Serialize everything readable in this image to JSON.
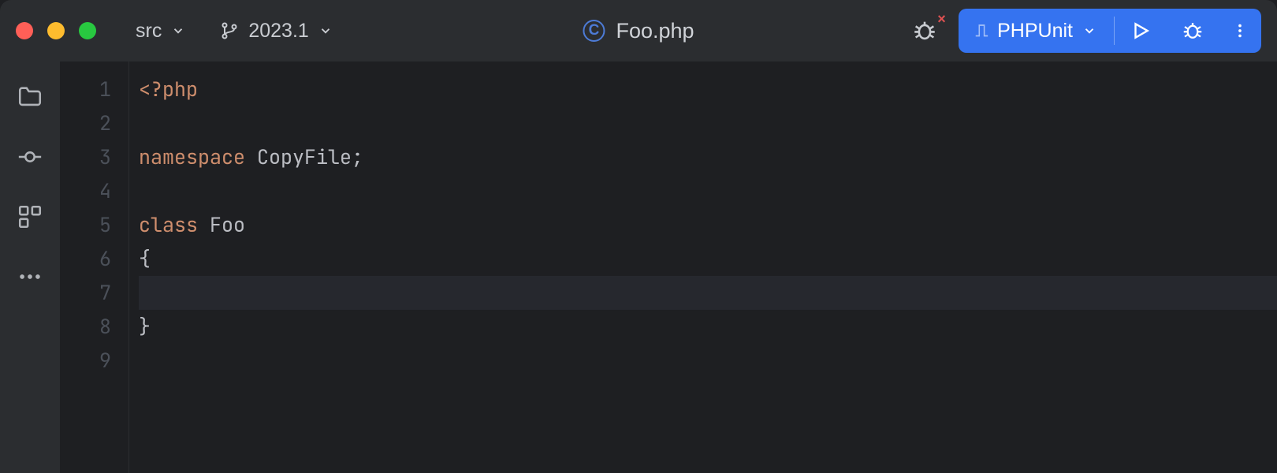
{
  "titlebar": {
    "project_crumb": "src",
    "branch": "2023.1",
    "file": {
      "badge": "C",
      "name": "Foo.php"
    },
    "run_config": "PHPUnit"
  },
  "editor": {
    "lines": [
      {
        "n": 1,
        "segments": [
          {
            "t": "<?php",
            "c": "tk-tag"
          }
        ]
      },
      {
        "n": 2,
        "segments": []
      },
      {
        "n": 3,
        "segments": [
          {
            "t": "namespace",
            "c": "tk-kw"
          },
          {
            "t": " ",
            "c": "tk-id"
          },
          {
            "t": "CopyFile",
            "c": "tk-id"
          },
          {
            "t": ";",
            "c": "tk-punc"
          }
        ]
      },
      {
        "n": 4,
        "segments": []
      },
      {
        "n": 5,
        "segments": [
          {
            "t": "class",
            "c": "tk-kw"
          },
          {
            "t": " ",
            "c": "tk-id"
          },
          {
            "t": "Foo",
            "c": "tk-id"
          }
        ]
      },
      {
        "n": 6,
        "segments": [
          {
            "t": "{",
            "c": "tk-punc"
          }
        ]
      },
      {
        "n": 7,
        "segments": [],
        "current": true
      },
      {
        "n": 8,
        "segments": [
          {
            "t": "}",
            "c": "tk-punc"
          }
        ]
      },
      {
        "n": 9,
        "segments": []
      }
    ]
  }
}
